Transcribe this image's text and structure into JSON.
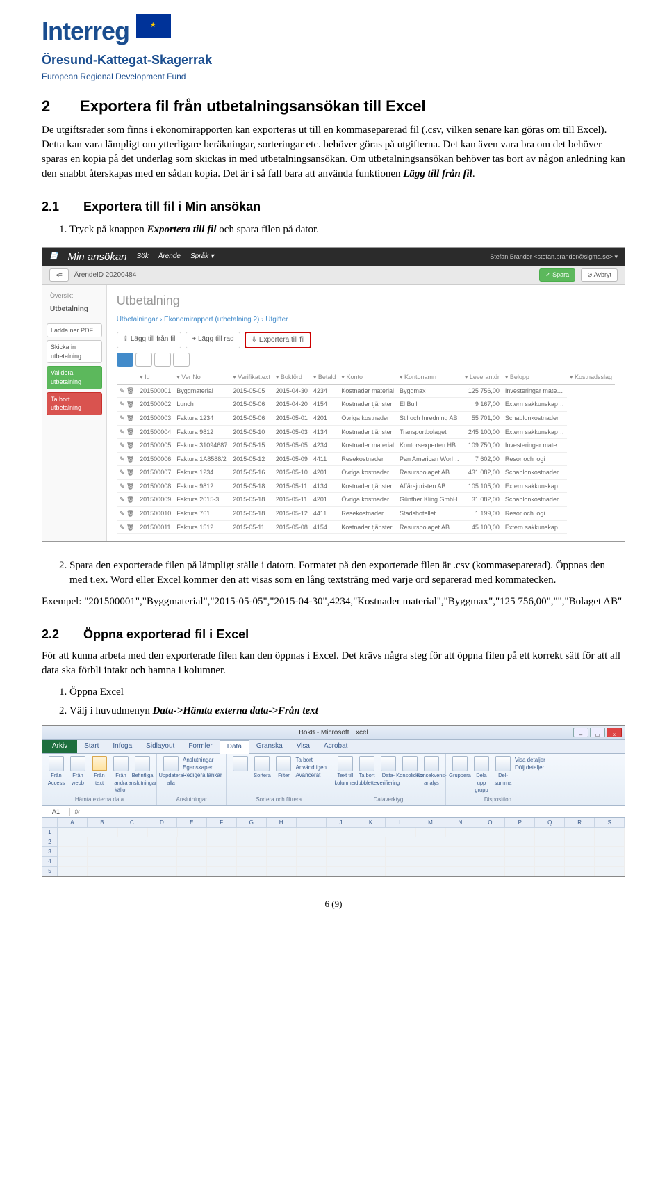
{
  "logo": {
    "brand": "Interreg",
    "subtitle": "Öresund-Kattegat-Skagerrak",
    "fund": "European Regional Development Fund"
  },
  "section2": {
    "number": "2",
    "title": "Exportera fil från utbetalningsansökan till Excel",
    "para": "De utgiftsrader som finns i ekonomirapporten kan exporteras ut till en kommaseparerad fil (.csv, vilken senare kan göras om till Excel). Detta kan vara lämpligt om ytterligare beräkningar, sorteringar etc. behöver göras på utgifterna. Det kan även vara bra om det behöver sparas en kopia på det underlag som skickas in med utbetalningsansökan. Om utbetalningsansökan behöver tas bort av någon anledning kan den snabbt återskapas med en sådan kopia. Det är i så fall bara att använda funktionen ",
    "para_em": "Lägg till från fil",
    "para_end": "."
  },
  "section21": {
    "number": "2.1",
    "title": "Exportera till fil i Min ansökan",
    "step1_a": "Tryck på knappen ",
    "step1_em": "Exportera till fil",
    "step1_b": " och spara filen på dator."
  },
  "ss1": {
    "app_title": "Min ansökan",
    "search": "Sök",
    "tab1": "Ärende",
    "tab2": "Språk ▾",
    "user": "Stefan Brander <stefan.brander@sigma.se> ▾",
    "arende": "ÄrendeID 20200484",
    "spara": "✓ Spara",
    "avbryt": "⊘ Avbryt",
    "side": {
      "oversikt": "Översikt",
      "utbetalning": "Utbetalning",
      "ladda": "Ladda ner PDF",
      "skicka": "Skicka in utbetalning",
      "validera": "Validera utbetalning",
      "tabort": "Ta bort utbetalning"
    },
    "main_h": "Utbetalning",
    "crumb": "Utbetalningar  ›  Ekonomirapport (utbetalning 2)  ›  Utgifter",
    "actions": {
      "laggfil": "⇪ Lägg till från fil",
      "laggrad": "+ Lägg till rad",
      "export": "⇩ Exportera till fil"
    },
    "cols": [
      "Id",
      "Ver No",
      "Verifikattext",
      "Bokförd",
      "Betald",
      "Konto",
      "Kontonamn",
      "Leverantör",
      "Belopp",
      "Kostnadsslag"
    ],
    "rows": [
      [
        "",
        "201500001",
        "Byggmaterial",
        "2015-05-05",
        "2015-04-30",
        "4234",
        "Kostnader material",
        "Byggmax",
        "125 756,00",
        "Investeringar mate…"
      ],
      [
        "",
        "201500002",
        "Lunch",
        "2015-05-06",
        "2015-04-20",
        "4154",
        "Kostnader tjänster",
        "El Bulli",
        "9 167,00",
        "Extern sakkunskap…"
      ],
      [
        "",
        "201500003",
        "Faktura 1234",
        "2015-05-06",
        "2015-05-01",
        "4201",
        "Övriga kostnader",
        "Stil och Inredning AB",
        "55 701,00",
        "Schablonkostnader"
      ],
      [
        "",
        "201500004",
        "Faktura 9812",
        "2015-05-10",
        "2015-05-03",
        "4134",
        "Kostnader tjänster",
        "Transportbolaget",
        "245 100,00",
        "Extern sakkunskap…"
      ],
      [
        "",
        "201500005",
        "Faktura 31094687",
        "2015-05-15",
        "2015-05-05",
        "4234",
        "Kostnader material",
        "Kontorsexperten HB",
        "109 750,00",
        "Investeringar mate…"
      ],
      [
        "",
        "201500006",
        "Faktura 1A8588/2",
        "2015-05-12",
        "2015-05-09",
        "4411",
        "Resekostnader",
        "Pan American Worl…",
        "7 602,00",
        "Resor och logi"
      ],
      [
        "",
        "201500007",
        "Faktura 1234",
        "2015-05-16",
        "2015-05-10",
        "4201",
        "Övriga kostnader",
        "Resursbolaget AB",
        "431 082,00",
        "Schablonkostnader"
      ],
      [
        "",
        "201500008",
        "Faktura 9812",
        "2015-05-18",
        "2015-05-11",
        "4134",
        "Kostnader tjänster",
        "Affärsjuristen AB",
        "105 105,00",
        "Extern sakkunskap…"
      ],
      [
        "",
        "201500009",
        "Faktura 2015-3",
        "2015-05-18",
        "2015-05-11",
        "4201",
        "Övriga kostnader",
        "Günther Kling GmbH",
        "31 082,00",
        "Schablonkostnader"
      ],
      [
        "",
        "201500010",
        "Faktura 761",
        "2015-05-18",
        "2015-05-12",
        "4411",
        "Resekostnader",
        "Stadshotellet",
        "1 199,00",
        "Resor och logi"
      ],
      [
        "",
        "201500011",
        "Faktura 1512",
        "2015-05-11",
        "2015-05-08",
        "4154",
        "Kostnader tjänster",
        "Resursbolaget AB",
        "45 100,00",
        "Extern sakkunskap…"
      ]
    ]
  },
  "step2": {
    "text": "Spara den exporterade filen på lämpligt ställe i datorn. Formatet på den exporterade filen är .csv (kommaseparerad). Öppnas den med t.ex. Word eller Excel kommer den att visas som en lång textsträng med varje ord separerad med kommatecken."
  },
  "exempel_label": "Exempel: ",
  "exempel": "\"201500001\",\"Byggmaterial\",\"2015-05-05\",\"2015-04-30\",4234,\"Kostnader material\",\"Byggmax\",\"125 756,00\",\"\",\"Bolaget AB\"",
  "section22": {
    "number": "2.2",
    "title": "Öppna exporterad fil i Excel",
    "para": "För att kunna arbeta med den exporterade filen kan den öppnas i Excel. Det krävs några steg för att öppna filen på ett korrekt sätt för att all data ska förbli intakt och hamna i kolumner.",
    "step1": "Öppna Excel",
    "step2_a": "Välj i huvudmenyn ",
    "step2_em": "Data->Hämta externa data->Från text"
  },
  "ss2": {
    "title": "Bok8 - Microsoft Excel",
    "file": "Arkiv",
    "tabs": [
      "Start",
      "Infoga",
      "Sidlayout",
      "Formler",
      "Data",
      "Granska",
      "Visa",
      "Acrobat"
    ],
    "active_tab": "Data",
    "groups": {
      "get": {
        "label": "Hämta externa data",
        "items": [
          "Från Access",
          "Från webb",
          "Från text",
          "Från andra källor",
          "Befintliga anslutningar"
        ]
      },
      "conn": {
        "label": "Anslutningar",
        "items": [
          "Uppdatera alla"
        ],
        "sub": [
          "Anslutningar",
          "Egenskaper",
          "Redigera länkar"
        ]
      },
      "sort": {
        "label": "Sortera och filtrera",
        "items": [
          "Sortera",
          "Filter",
          "Avancerat"
        ],
        "sub": [
          "Ta bort",
          "Använd igen"
        ]
      },
      "tools": {
        "label": "Dataverktyg",
        "items": [
          "Text till kolumner",
          "Ta bort dubbletter",
          "Data-verifiering",
          "Konsolidera",
          "Konsekvens-analys"
        ]
      },
      "outline": {
        "label": "Disposition",
        "items": [
          "Gruppera",
          "Dela upp grupp",
          "Del-summa"
        ],
        "sub": [
          "Visa detaljer",
          "Dölj detaljer"
        ]
      }
    },
    "cell": "A1",
    "cols": [
      "A",
      "B",
      "C",
      "D",
      "E",
      "F",
      "G",
      "H",
      "I",
      "J",
      "K",
      "L",
      "M",
      "N",
      "O",
      "P",
      "Q",
      "R",
      "S"
    ],
    "rows": [
      "1",
      "2",
      "3",
      "4",
      "5"
    ]
  },
  "pagenum": "6 (9)"
}
